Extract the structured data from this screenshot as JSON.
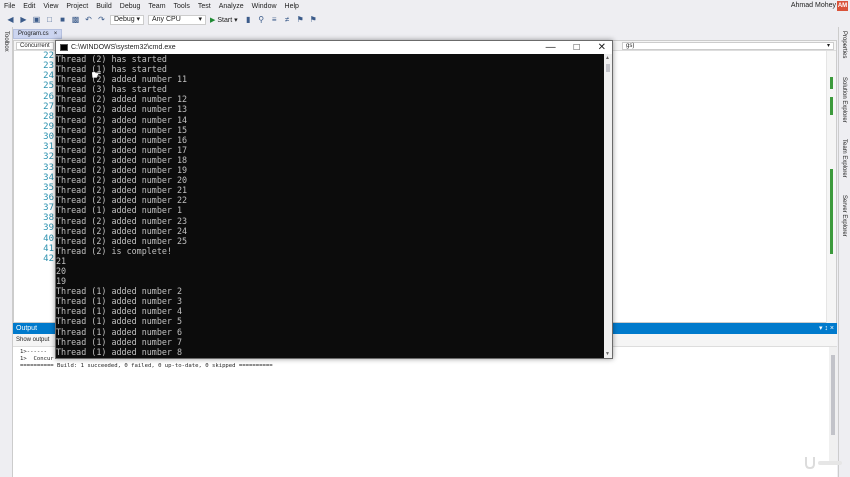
{
  "menu": [
    "File",
    "Edit",
    "View",
    "Project",
    "Build",
    "Debug",
    "Team",
    "Tools",
    "Test",
    "Analyze",
    "Window",
    "Help"
  ],
  "profile": {
    "name": "Ahmad Mohey",
    "initials": "AM"
  },
  "toolbar": {
    "config": "Debug",
    "platform": "Any CPU",
    "start_label": "Start"
  },
  "side_panels": {
    "left": "Toolbox",
    "right": [
      "Properties",
      "Solution Explorer",
      "Team Explorer",
      "Server Explorer"
    ]
  },
  "doc_tabs": [
    {
      "label": "Program.cs"
    }
  ],
  "editor": {
    "nav_left": "Concurrent",
    "nav_right": "gs)",
    "line_numbers": [
      "22",
      "23",
      "24",
      "25",
      "26",
      "27",
      "28",
      "29",
      "30",
      "31",
      "32",
      "33",
      "34",
      "35",
      "36",
      "37",
      "38",
      "39",
      "40",
      "41",
      "42"
    ]
  },
  "console": {
    "title": "C:\\WINDOWS\\system32\\cmd.exe",
    "lines": [
      "Thread (2) has started",
      "Thread (1) has started",
      "Thread (2) added number 11",
      "Thread (3) has started",
      "Thread (2) added number 12",
      "Thread (2) added number 13",
      "Thread (2) added number 14",
      "Thread (2) added number 15",
      "Thread (2) added number 16",
      "Thread (2) added number 17",
      "Thread (2) added number 18",
      "Thread (2) added number 19",
      "Thread (2) added number 20",
      "Thread (2) added number 21",
      "Thread (2) added number 22",
      "Thread (1) added number 1",
      "Thread (2) added number 23",
      "Thread (2) added number 24",
      "Thread (2) added number 25",
      "Thread (2) is complete!",
      "21",
      "20",
      "19",
      "Thread (1) added number 2",
      "Thread (1) added number 3",
      "Thread (1) added number 4",
      "Thread (1) added number 5",
      "Thread (1) added number 6",
      "Thread (1) added number 7",
      "Thread (1) added number 8"
    ]
  },
  "output": {
    "title": "Output",
    "show_output_from": "Show output",
    "lines": [
      "1>------",
      "1>  Concur",
      "========== Build: 1 succeeded, 0 failed, 0 up-to-date, 0 skipped =========="
    ]
  },
  "colors": {
    "accent": "#007acc",
    "console_bg": "#0c0c0c",
    "console_fg": "#c0c0c0",
    "line_number": "#2b91af"
  }
}
